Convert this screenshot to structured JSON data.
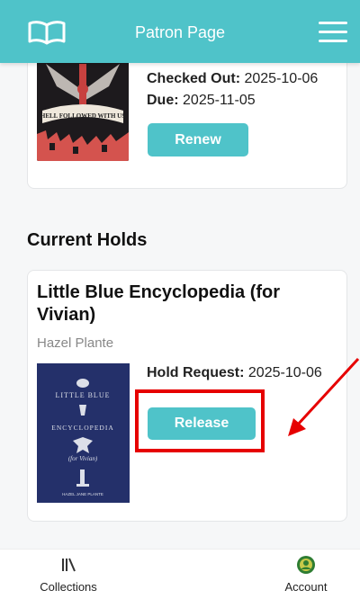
{
  "header": {
    "title": "Patron Page",
    "logo_icon": "open-book-icon",
    "menu_icon": "hamburger-menu-icon"
  },
  "checkout_item": {
    "cover_text": "HELL FOLLOWED WITH US",
    "checked_out_label": "Checked Out:",
    "checked_out_value": "2025-10-06",
    "due_label": "Due:",
    "due_value": "2025-11-05",
    "renew_label": "Renew"
  },
  "holds": {
    "section_title": "Current Holds",
    "items": [
      {
        "title": "Little Blue Encyclopedia (for Vivian)",
        "author": "Hazel Plante",
        "cover_line1": "LITTLE BLUE",
        "cover_line2": "ENCYCLOPEDIA",
        "cover_line3": "(for Vivian)",
        "cover_author": "HAZEL JANE PLANTE",
        "hold_request_label": "Hold Request:",
        "hold_request_value": "2025-10-06",
        "release_label": "Release"
      }
    ]
  },
  "bottom_nav": {
    "items": [
      {
        "label": "Collections",
        "icon": "library-books-icon"
      },
      {
        "label": "Account",
        "icon": "account-avatar-icon"
      }
    ]
  },
  "colors": {
    "accent": "#4fc3c9",
    "annotation": "#e60000",
    "cover_blue": "#24306a"
  }
}
